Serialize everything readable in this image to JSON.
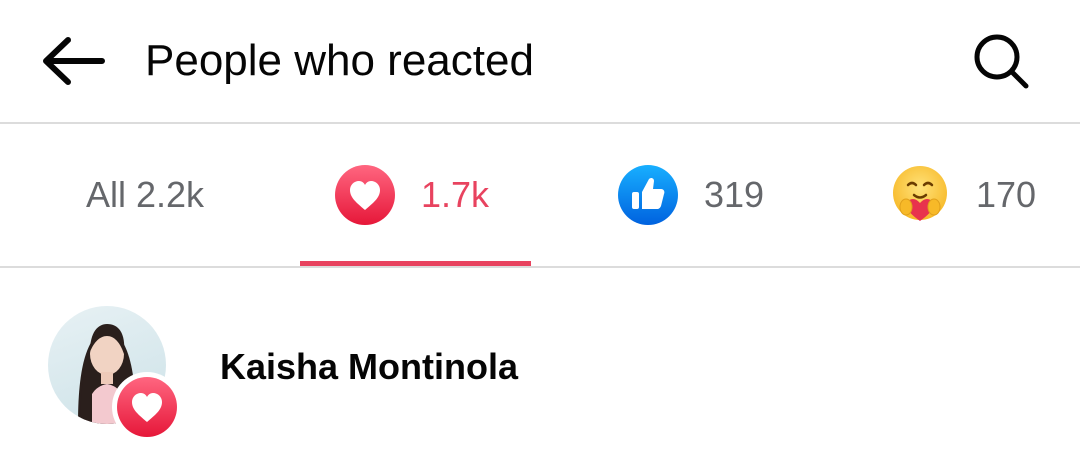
{
  "header": {
    "title": "People who reacted",
    "back_icon": "back-arrow-icon",
    "search_icon": "search-icon"
  },
  "tabs": [
    {
      "label": "All 2.2k",
      "selected": false
    },
    {
      "label": "1.7k",
      "icon": "love-reaction-icon",
      "selected": true,
      "accent": "#e8435f"
    },
    {
      "label": "319",
      "icon": "like-reaction-icon",
      "selected": false,
      "accent": "#1877f2"
    },
    {
      "label": "170",
      "icon": "care-reaction-icon",
      "selected": false,
      "accent": "#f7b928"
    }
  ],
  "people": [
    {
      "name": "Kaisha Montinola",
      "reaction": "love-reaction-icon"
    }
  ]
}
